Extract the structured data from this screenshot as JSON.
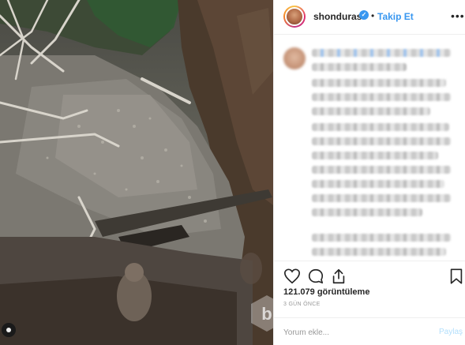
{
  "header": {
    "username": "shonduras",
    "verified_icon": "verified-badge-icon",
    "separator": "•",
    "follow_label": "Takip Et",
    "more_label": "•••"
  },
  "caption": {
    "blurred": true
  },
  "actions": {
    "like_icon": "heart-icon",
    "comment_icon": "comment-icon",
    "share_icon": "share-icon",
    "save_icon": "bookmark-icon"
  },
  "stats": {
    "views": "121.079 görüntüleme",
    "time_ago": "3 GÜN ÖNCE"
  },
  "comment": {
    "placeholder": "Yorum ekle...",
    "post_label": "Paylaş"
  },
  "colors": {
    "accent": "#3897f0",
    "post_disabled": "#b2dffc",
    "muted": "#999999",
    "text": "#262626"
  }
}
